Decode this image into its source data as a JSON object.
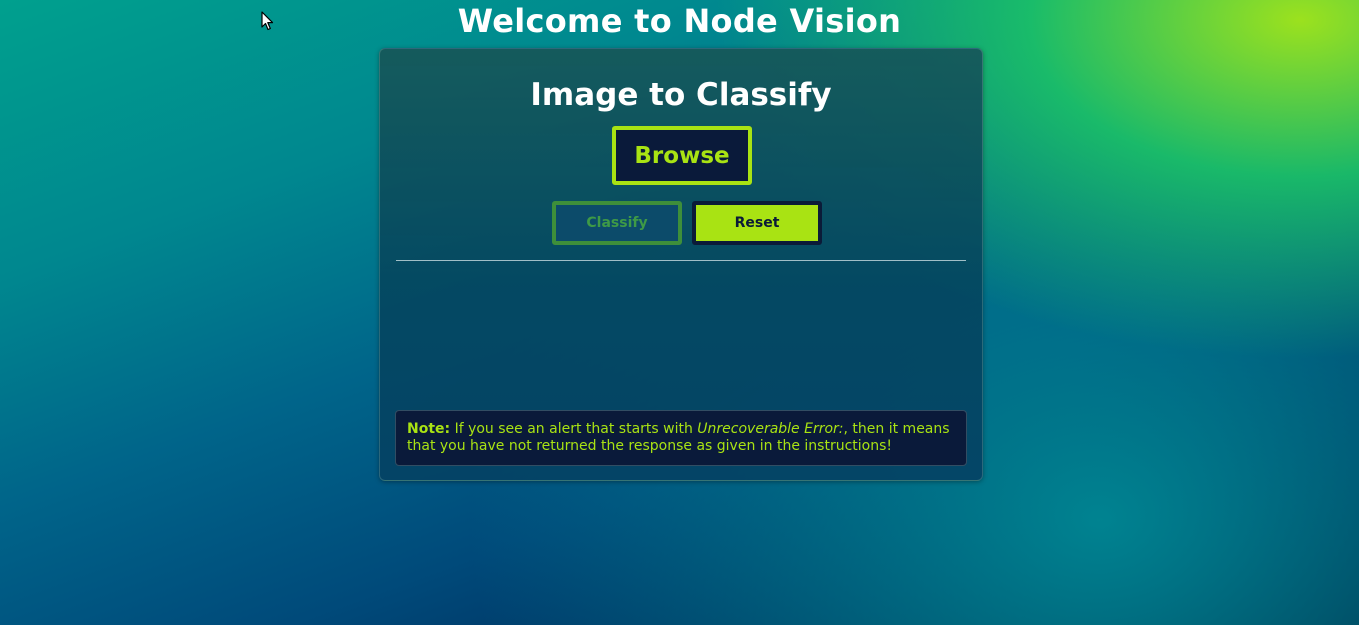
{
  "page": {
    "title": "Welcome to Node Vision"
  },
  "card": {
    "title": "Image to Classify",
    "browse_label": "Browse",
    "classify_label": "Classify",
    "reset_label": "Reset",
    "note": {
      "label": "Note:",
      "text_before": " If you see an alert that starts with ",
      "emphasis": "Unrecoverable Error:",
      "text_after": ", then it means that you have not returned the response as given in the instructions!"
    }
  },
  "icons": {
    "cursor": "mouse-pointer-icon"
  },
  "colors": {
    "accent": "#a9e313",
    "dark": "#0a1a3a",
    "disabled_border": "#3e8f3a"
  }
}
